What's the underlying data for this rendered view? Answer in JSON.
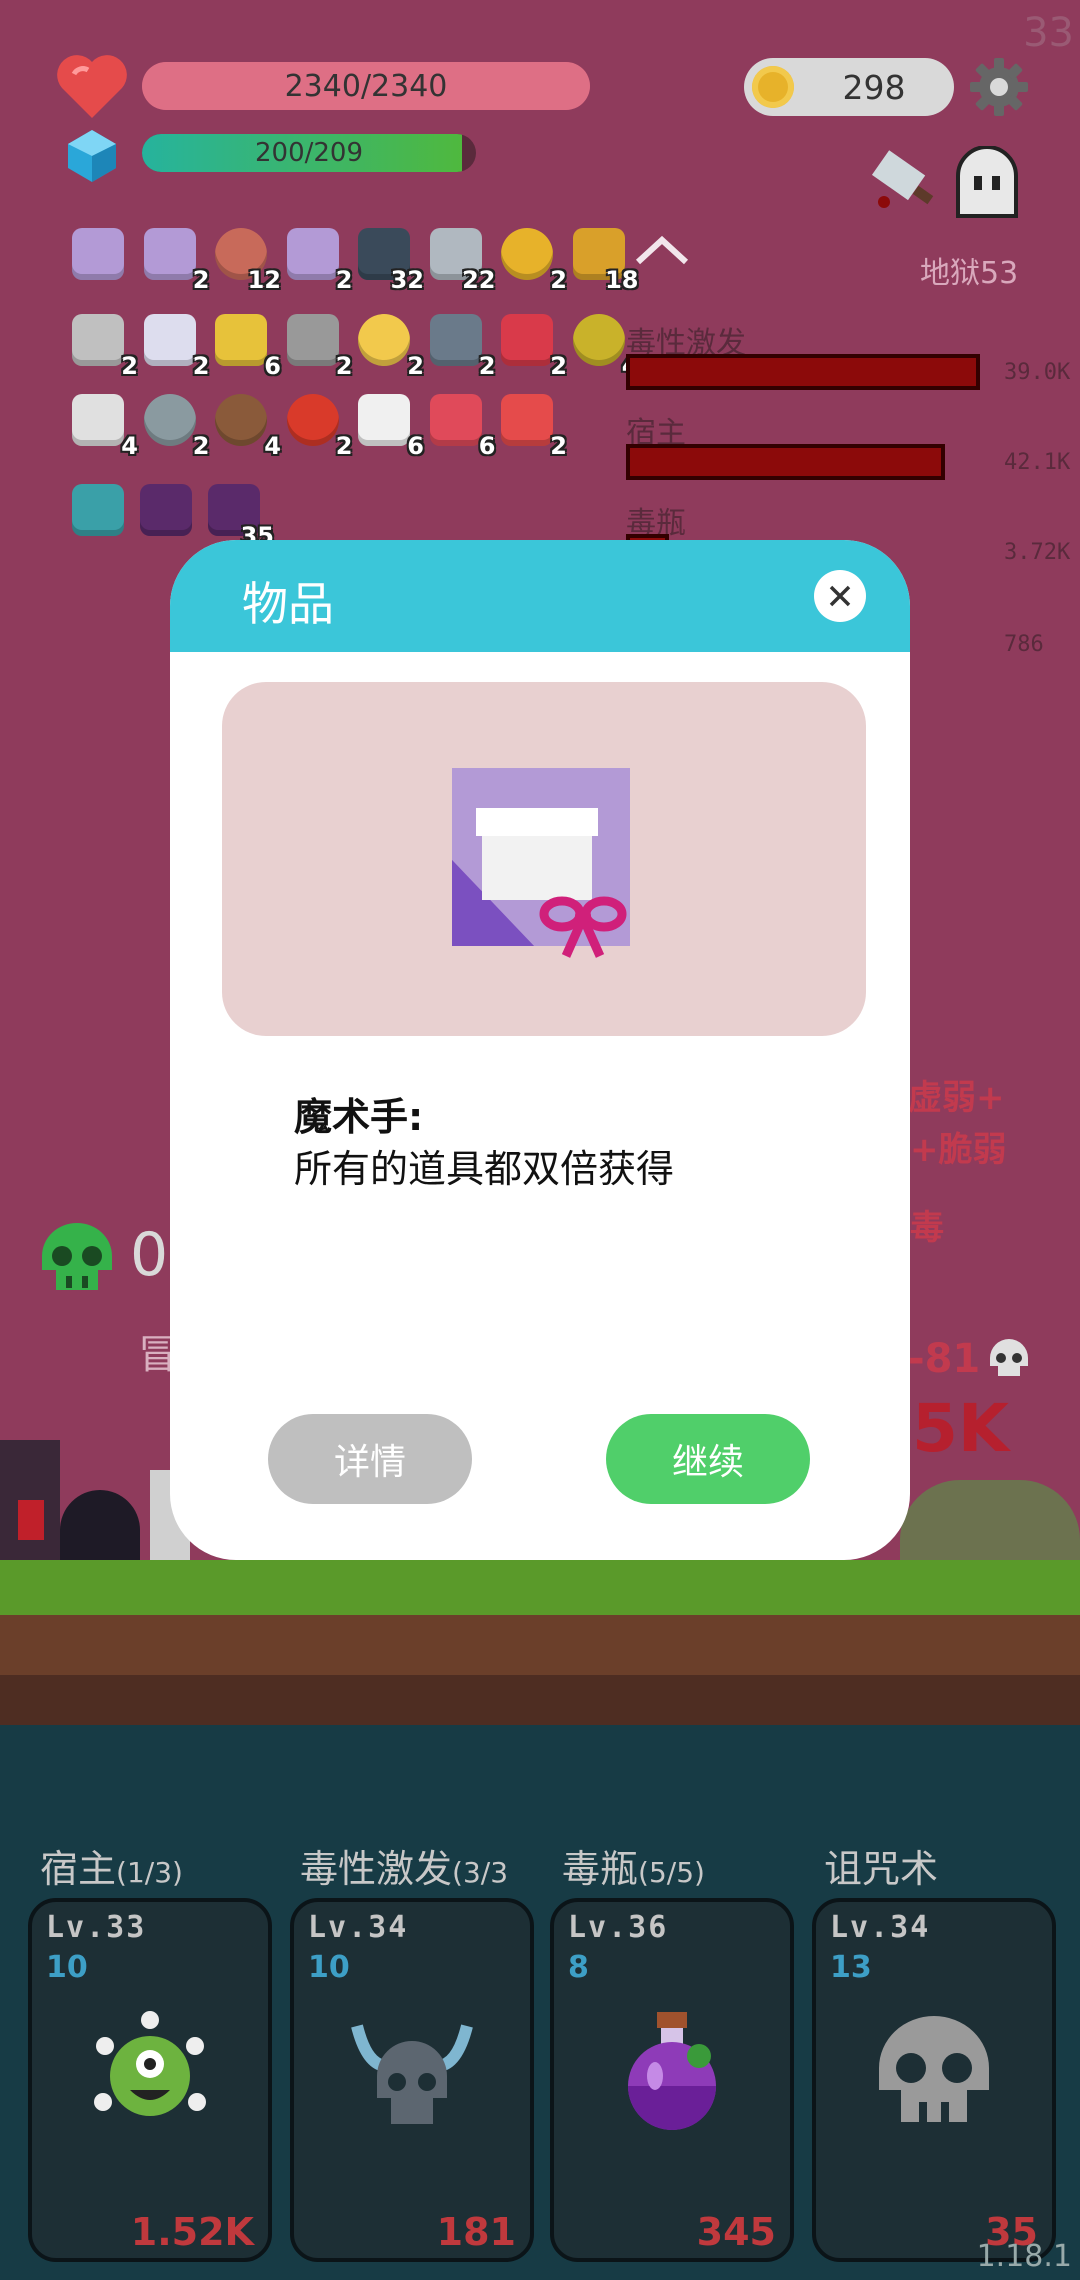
{
  "hud": {
    "corner_number": "33",
    "hp_text": "2340/2340",
    "hp_fraction": 1.0,
    "mana_text": "200/209",
    "mana_fraction": 0.957,
    "coins": "298",
    "level_label": "地狱53",
    "kill_count": "0"
  },
  "items": [
    {
      "icon": "gift-card-icon",
      "count": ""
    },
    {
      "icon": "gift-card-icon",
      "count": "2"
    },
    {
      "icon": "fan-icon",
      "count": "12"
    },
    {
      "icon": "gift-card-icon",
      "count": "2"
    },
    {
      "icon": "book-icon",
      "count": "32"
    },
    {
      "icon": "sword-icon",
      "count": "22"
    },
    {
      "icon": "ring-icon",
      "count": "2"
    },
    {
      "icon": "spellbook-icon",
      "count": "18"
    },
    {
      "icon": "hook-icon",
      "count": "2"
    },
    {
      "icon": "dagger-icon",
      "count": "2"
    },
    {
      "icon": "battery-icon",
      "count": "6"
    },
    {
      "icon": "meteor-icon",
      "count": "2"
    },
    {
      "icon": "sun-icon",
      "count": "2"
    },
    {
      "icon": "horned-skull-icon",
      "count": "2"
    },
    {
      "icon": "gem-icon",
      "count": "2"
    },
    {
      "icon": "egg-icon",
      "count": "4"
    },
    {
      "icon": "envelope-icon",
      "count": "4"
    },
    {
      "icon": "spiked-ball-icon",
      "count": "2"
    },
    {
      "icon": "shield-icon",
      "count": "4"
    },
    {
      "icon": "apple-icon",
      "count": "2"
    },
    {
      "icon": "flower-icon",
      "count": "6"
    },
    {
      "icon": "watermelon-icon",
      "count": "6"
    },
    {
      "icon": "heart-icon",
      "count": "2"
    },
    {
      "icon": "lightbulb-tile-icon",
      "count": ""
    },
    {
      "icon": "demon-tile-icon",
      "count": ""
    },
    {
      "icon": "demon-tile-icon",
      "count": "35"
    }
  ],
  "damage_stats": [
    {
      "label": "毒性激发",
      "value": "39.0K",
      "fraction": 1.0
    },
    {
      "label": "宿主",
      "value": "42.1K",
      "fraction": 0.9
    },
    {
      "label": "毒瓶",
      "value": "3.72K",
      "fraction": 0.1
    },
    {
      "label": "",
      "value": "786",
      "fraction": 0.02
    }
  ],
  "background_text": {
    "status1": "虚弱+",
    "status2": "+脆弱",
    "status3": "毒",
    "floating_damage": "-81",
    "big_damage": "5K",
    "left_label": "冒"
  },
  "modal": {
    "title": "物品",
    "item_name": "魔术手:",
    "item_desc": "所有的道具都双倍获得",
    "details_label": "详情",
    "continue_label": "继续"
  },
  "skills": [
    {
      "title": "宿主",
      "count": "(1/3)",
      "level": "Lv.33",
      "num": "10",
      "damage": "1.52K",
      "icon": "eyeball-monster-icon"
    },
    {
      "title": "毒性激发",
      "count": "(3/3",
      "level": "Lv.34",
      "num": "10",
      "damage": "181",
      "icon": "horned-skull-icon"
    },
    {
      "title": "毒瓶",
      "count": "(5/5)",
      "level": "Lv.36",
      "num": "8",
      "damage": "345",
      "icon": "poison-flask-icon"
    },
    {
      "title": "诅咒术",
      "count": "",
      "level": "Lv.34",
      "num": "13",
      "damage": "35",
      "icon": "skull-icon"
    }
  ],
  "version": "1.18.1",
  "colors": {
    "background": "#8f3b5c",
    "modal_header": "#3bc6d9",
    "continue_button": "#50cf6a",
    "details_button": "#bfbfbf",
    "damage_red": "#c0393d",
    "level_blue": "#3d9fc6"
  }
}
